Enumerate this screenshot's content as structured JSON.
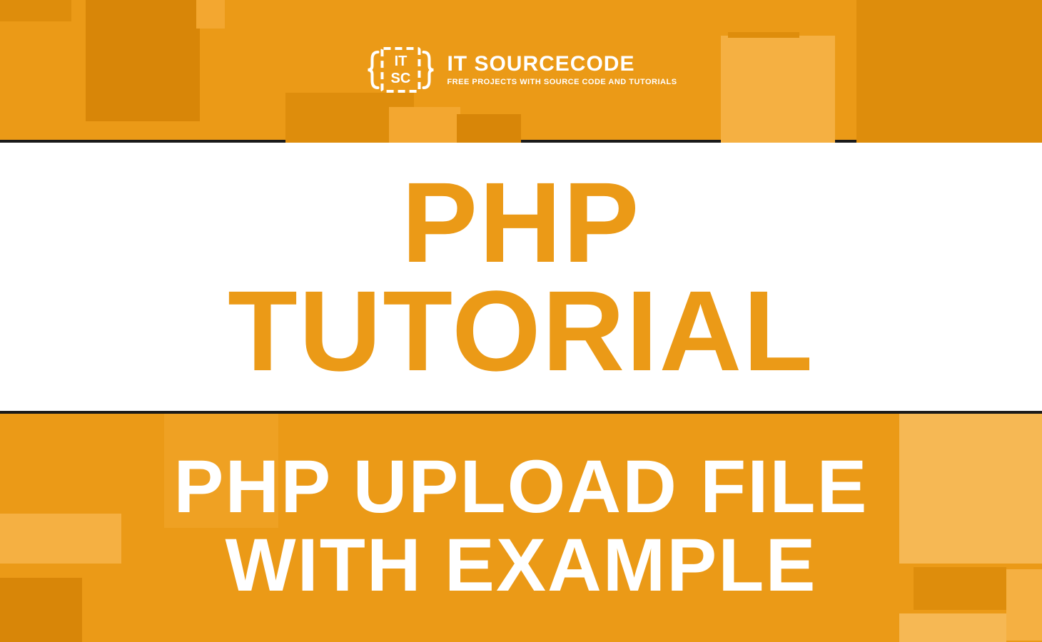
{
  "colors": {
    "primary": "#eb9a17",
    "darkOrange1": "#de8d0c",
    "darkOrange2": "#d88608",
    "lightOrange1": "#f3a730",
    "lightOrange2": "#f5b042",
    "lightOrange3": "#f6b854",
    "white": "#ffffff",
    "dark": "#1a1a1a"
  },
  "logo": {
    "title": "IT SOURCECODE",
    "subtitle": "FREE PROJECTS WITH SOURCE CODE AND TUTORIALS"
  },
  "main": {
    "title": "PHP\nTUTORIAL"
  },
  "sub": {
    "title": "PHP UPLOAD FILE\nWITH EXAMPLE"
  }
}
